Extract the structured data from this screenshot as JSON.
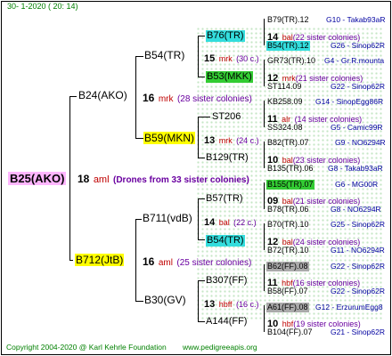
{
  "header": {
    "date": "30-   1-2020  ( 20:  14)"
  },
  "root": {
    "name": "B25(AKO)",
    "num": "18",
    "abbrev": "aml",
    "drones": "(Drones from 33 sister colonies)"
  },
  "g1": [
    {
      "name": "B24(AKO)",
      "num": "16",
      "abbrev": "mrk",
      "sisters": "(28 sister colonies)"
    },
    {
      "name": "B712(JtB)",
      "num": "16",
      "abbrev": "aml",
      "sisters": "(25 sister colonies)"
    }
  ],
  "g2": [
    {
      "name": "B54(TR)",
      "num": "15",
      "abbrev": "mrk",
      "sisters": "(30 c.)"
    },
    {
      "name": "B59(MKN)",
      "num": "13",
      "abbrev": "mrk",
      "sisters": "(24 c.)"
    },
    {
      "name": "B711(vdB)",
      "num": "14",
      "abbrev": "bal",
      "sisters": "(22 c.)"
    },
    {
      "name": "B30(GV)",
      "num": "13",
      "abbrev": "hbff",
      "sisters": "(16 c.)"
    }
  ],
  "g3": [
    {
      "name": "B76(TR)",
      "num": "14",
      "abbrev": "bal",
      "sisters": "(22 sister colonies)"
    },
    {
      "name": "B53(MKK)",
      "num": "12",
      "abbrev": "mrk",
      "sisters": "(21 sister colonies)"
    },
    {
      "name": "ST206",
      "num": "11",
      "abbrev": "alr",
      "sisters": "(14 sister colonies)"
    },
    {
      "name": "B129(TR)",
      "num": "10",
      "abbrev": "bal",
      "sisters": "(23 sister colonies)"
    },
    {
      "name": "B57(TR)",
      "num": "09",
      "abbrev": "bal",
      "sisters": "(21 sister colonies)"
    },
    {
      "name": "B54(TR)",
      "num": "12",
      "abbrev": "bal",
      "sisters": "(24 sister colonies)"
    },
    {
      "name": "B307(FF)",
      "num": "11",
      "abbrev": "hbf",
      "sisters": "(16 sister colonies)"
    },
    {
      "name": "A144(FF)",
      "num": "10",
      "abbrev": "hbf",
      "sisters": "(19 sister colonies)"
    }
  ],
  "g4": [
    {
      "name": "B79(TR).12",
      "site": "G10 - Takab93aR"
    },
    {
      "name": "B54(TR).12",
      "site": "G26 - Sinop62R"
    },
    {
      "name": "GR73(TR).10",
      "site": "G4 - Gr.R.mounta"
    },
    {
      "name": "ST114.09",
      "site": "G22 - Sinop62R"
    },
    {
      "name": "KB258.09",
      "site": "G14 - SinopEgg86R"
    },
    {
      "name": "SS324.08",
      "site": "G5 - Camic99R"
    },
    {
      "name": "B82(TR).07",
      "site": "G9 - NO6294R"
    },
    {
      "name": "B135(TR).06",
      "site": "G8 - Takab93aR"
    },
    {
      "name": "B155(TR).07",
      "site": "G6 - MG00R"
    },
    {
      "name": "B78(TR).06",
      "site": "G8 - NO6294R"
    },
    {
      "name": "B70(TR).10",
      "site": "G25 - Sinop62R"
    },
    {
      "name": "B72(TR).10",
      "site": "G11 - NO6294R"
    },
    {
      "name": "B62(FF).08",
      "site": "G22 - Sinop62R"
    },
    {
      "name": "B58(FF).07",
      "site": "G22 - Sinop62R"
    },
    {
      "name": "A61(FF).08",
      "site": "G12 - ErzurumEgg8"
    },
    {
      "name": "B104(FF).07",
      "site": "G21 - Sinop62R"
    }
  ],
  "footer": {
    "copyright": "Copyright 2004-2020 @ Karl Kehrle Foundation",
    "website": "www.pedigreeapis.org"
  }
}
